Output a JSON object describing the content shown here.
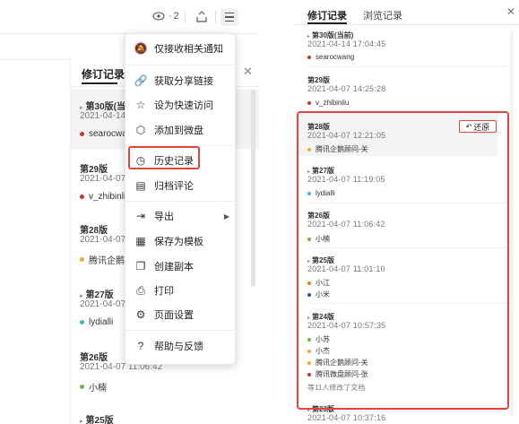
{
  "left": {
    "viewers": "2",
    "panel_title": "修订记录",
    "items": [
      {
        "version": "第30版(当前)",
        "time": "2021-04-14 1",
        "user": "searocwan",
        "color": "#c0392b"
      },
      {
        "version": "第29版",
        "time": "2021-04-07 1",
        "user": "v_zhibinliu",
        "color": "#c0392b"
      },
      {
        "version": "第28版",
        "time": "2021-04-07 1",
        "user": "腾讯企鹅顾",
        "color": "#f2a733"
      },
      {
        "version": "第27版",
        "time": "2021-04-07 1",
        "user": "lydialli",
        "color": "#3fb6cf"
      },
      {
        "version": "第26版",
        "time": "2021-04-07 11:06:42",
        "user": "小楠",
        "color": "#7cb342"
      },
      {
        "version": "第25版",
        "time": "",
        "user": "",
        "color": ""
      }
    ]
  },
  "menu": {
    "items": [
      {
        "icon": "bell-off-icon",
        "glyph": "🔕",
        "label": "仅接收相关通知"
      },
      {
        "icon": "link-icon",
        "glyph": "🔗",
        "label": "获取分享链接"
      },
      {
        "icon": "star-icon",
        "glyph": "☆",
        "label": "设为快速访问"
      },
      {
        "icon": "weiyun-icon",
        "glyph": "⬡",
        "label": "添加到微盘"
      },
      {
        "icon": "clock-icon",
        "glyph": "◷",
        "label": "历史记录"
      },
      {
        "icon": "archive-icon",
        "glyph": "▤",
        "label": "归档评论"
      },
      {
        "icon": "export-icon",
        "glyph": "⇥",
        "label": "导出"
      },
      {
        "icon": "template-icon",
        "glyph": "▦",
        "label": "保存为模板"
      },
      {
        "icon": "copy-icon",
        "glyph": "❐",
        "label": "创建副本"
      },
      {
        "icon": "print-icon",
        "glyph": "⎙",
        "label": "打印"
      },
      {
        "icon": "page-settings-icon",
        "glyph": "⚙",
        "label": "页面设置"
      },
      {
        "icon": "help-icon",
        "glyph": "?",
        "label": "帮助与反馈"
      }
    ]
  },
  "right": {
    "tab_active": "修订记录",
    "tab_inactive": "浏览记录",
    "restore_label": "还原",
    "more_text": "等11人修改了文档",
    "items": [
      {
        "version": "第30版(当前)",
        "time": "2021-04-14 17:04:45",
        "users": [
          {
            "name": "searocwang",
            "color": "#c0392b"
          }
        ]
      },
      {
        "version": "第29版",
        "time": "2021-04-07 14:25:28",
        "users": [
          {
            "name": "v_zhibinliu",
            "color": "#c0392b"
          }
        ]
      },
      {
        "version": "第28版",
        "time": "2021-04-07 12:21:05",
        "users": [
          {
            "name": "腾讯企鹅顾问-关",
            "color": "#f2a733"
          }
        ]
      },
      {
        "version": "第27版",
        "time": "2021-04-07 11:19:05",
        "users": [
          {
            "name": "lydialli",
            "color": "#3fb6cf"
          }
        ]
      },
      {
        "version": "第26版",
        "time": "2021-04-07 11:06:42",
        "users": [
          {
            "name": "小楠",
            "color": "#7cb342"
          }
        ]
      },
      {
        "version": "第25版",
        "time": "2021-04-07 11:01:10",
        "users": [
          {
            "name": "小江",
            "color": "#e67e22"
          },
          {
            "name": "小米",
            "color": "#3949ab"
          }
        ]
      },
      {
        "version": "第24版",
        "time": "2021-04-07 10:57:35",
        "users": [
          {
            "name": "小苏",
            "color": "#7cb342"
          },
          {
            "name": "小杰",
            "color": "#f2a733"
          },
          {
            "name": "腾讯企鹅顾问-关",
            "color": "#f2a733"
          },
          {
            "name": "腾讯微盘顾问-张",
            "color": "#c0392b"
          }
        ]
      },
      {
        "version": "第23版",
        "time": "2021-04-07 10:37:16",
        "users": []
      }
    ]
  },
  "colors": {
    "highlight": "#e0463a"
  }
}
